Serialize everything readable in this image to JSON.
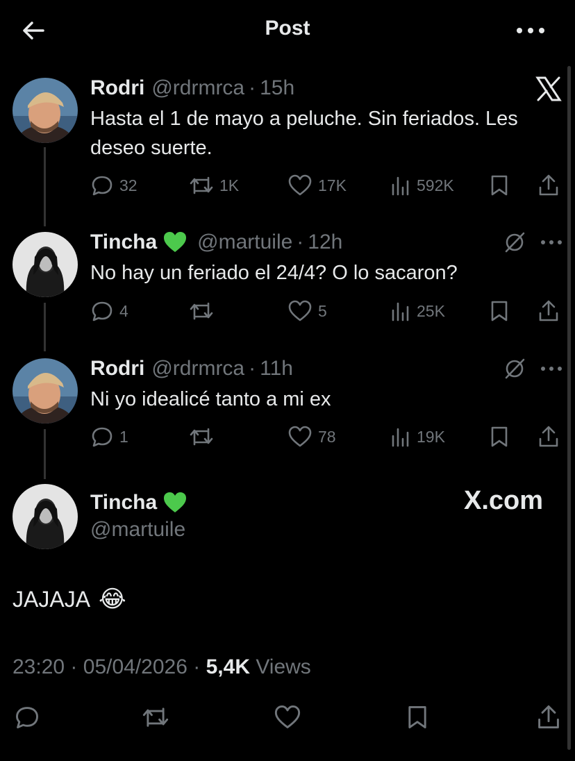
{
  "header": {
    "title": "Post",
    "back_icon": "arrow-left-icon",
    "more_icon": "more-horizontal-icon"
  },
  "colors": {
    "background": "#000000",
    "text": "#e7e9ea",
    "muted": "#71767b",
    "heart_green": "#4cc94c"
  },
  "replies": [
    {
      "name": "Rodri",
      "handle": "@rdrmrca",
      "dot": "·",
      "time": "15h",
      "text_line1": "Hasta el 1 de mayo a peluche. Sin feriados. Les",
      "text_line2": "deseo suerte.",
      "stats": {
        "replies": "32",
        "reposts": "1K",
        "likes": "17K",
        "views": "592K"
      }
    },
    {
      "name": "Tincha",
      "handle": "@martuile",
      "dot": "·",
      "time": "12h",
      "text_line1": "No hay un feriado el 24/4? O lo sacaron?",
      "stats": {
        "replies": "4",
        "reposts": "",
        "likes": "5",
        "views": "25K"
      }
    },
    {
      "name": "Rodri",
      "handle": "@rdrmrca",
      "dot": "·",
      "time": "11h",
      "text_line1": "Ni yo idealicé tanto a mi ex",
      "stats": {
        "replies": "1",
        "reposts": "",
        "likes": "78",
        "views": "19K"
      }
    }
  ],
  "main_post": {
    "name": "Tincha",
    "handle": "@martuile",
    "text": "JAJAJA",
    "emoji": "😂",
    "time": "23:20",
    "sep1": "·",
    "date": "05/04/2026",
    "sep2": "·",
    "views_count": "5,4K",
    "views_label": "Views",
    "watermark": "X.com"
  }
}
